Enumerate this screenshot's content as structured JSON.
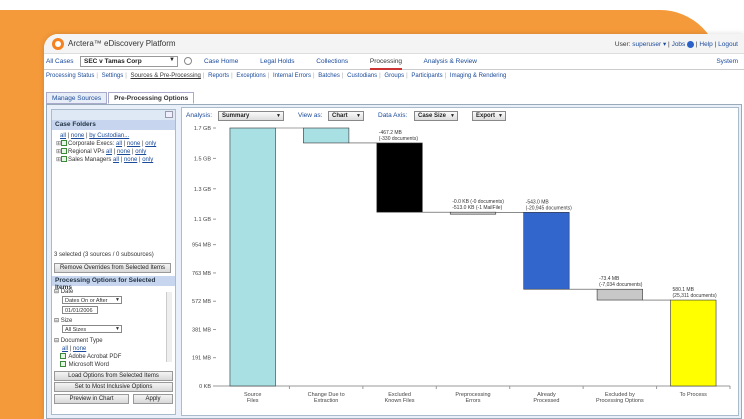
{
  "app": {
    "title": "Arctera™ eDiscovery Platform"
  },
  "userbar": {
    "user_label": "User:",
    "user": "superuser ▾",
    "jobs": "Jobs",
    "help": "Help",
    "logout": "Logout"
  },
  "nav": {
    "all_cases": "All Cases",
    "case_selected": "SEC v Tamas Corp",
    "items": [
      "Case Home",
      "Legal Holds",
      "Collections",
      "Processing",
      "Analysis & Review"
    ],
    "active": "Processing",
    "system": "System"
  },
  "subnav": {
    "items": [
      "Processing Status",
      "Settings",
      "Sources & Pre-Processing",
      "Reports",
      "Exceptions",
      "Internal Errors",
      "Batches",
      "Custodians",
      "Groups",
      "Participants",
      "Imaging & Rendering"
    ],
    "active": "Sources & Pre-Processing"
  },
  "tabs": [
    "Manage Sources",
    "Pre-Processing Options"
  ],
  "left": {
    "case_folders_title": "Case Folders",
    "top_links": [
      "all",
      "none",
      "by Custodian..."
    ],
    "folders": [
      {
        "name": "Corporate Execs",
        "links": [
          "all",
          "none",
          "only"
        ]
      },
      {
        "name": "Regional VPs",
        "links": [
          "all",
          "none",
          "only"
        ]
      },
      {
        "name": "Sales Managers",
        "links": [
          "all",
          "none",
          "only"
        ]
      }
    ],
    "selected_info": "3 selected (3 sources / 0 subsources)",
    "remove_btn": "Remove Overrides from Selected Items",
    "options_title": "Processing Options for Selected Items",
    "date_label": "Date",
    "date_mode": "Dates On or After",
    "date_value": "01/01/2006",
    "size_label": "Size",
    "size_value": "All Sizes",
    "doctype_label": "Document Type",
    "doctype_links": [
      "all",
      "none"
    ],
    "doctypes": [
      "Adobe Acrobat PDF",
      "Microsoft Word"
    ],
    "load_btn": "Load Options from Selected Items",
    "inclusive_btn": "Set to Most Inclusive Options",
    "preview_btn": "Preview in Chart",
    "apply_btn": "Apply"
  },
  "chart_controls": {
    "analysis_label": "Analysis:",
    "analysis_value": "Summary",
    "viewas_label": "View as:",
    "viewas_value": "Chart",
    "axis_label": "Data Axis:",
    "axis_value": "Case Size",
    "export": "Export"
  },
  "chart_data": {
    "type": "bar",
    "subtype": "waterfall",
    "y_ticks": [
      "1.7 GB",
      "1.5 GB",
      "1.3 GB",
      "1.1 GB",
      "954 MB",
      "763 MB",
      "572 MB",
      "381 MB",
      "191 MB",
      "0 KB"
    ],
    "y_tick_values_mb": [
      1741,
      1536,
      1331,
      1126,
      954,
      763,
      572,
      381,
      191,
      0
    ],
    "categories": [
      "Source\nFiles",
      "Change Due to\nExtraction",
      "Excluded\nKnown Files",
      "Preprocessing\nErrors",
      "Already\nProcessed",
      "Excluded by\nProcessing Options",
      "To Process"
    ],
    "bars": [
      {
        "category": "Source Files",
        "start_mb": 0,
        "end_mb": 1741,
        "color": "#a8e0e4"
      },
      {
        "category": "Change Due to Extraction",
        "start_mb": 1741,
        "end_mb": 1640,
        "color": "#a8e0e4"
      },
      {
        "category": "Excluded Known Files",
        "start_mb": 1640,
        "end_mb": 1173,
        "color": "#000000"
      },
      {
        "category": "Preprocessing Errors",
        "start_mb": 1173,
        "end_mb": 1172,
        "color": "#d0d0d0"
      },
      {
        "category": "Already Processed",
        "start_mb": 1172,
        "end_mb": 653,
        "color": "#3366cc"
      },
      {
        "category": "Excluded by Processing Options",
        "start_mb": 653,
        "end_mb": 580,
        "color": "#c8c8c8"
      },
      {
        "category": "To Process",
        "start_mb": 580,
        "end_mb": 0,
        "color": "#ffff00"
      }
    ],
    "annotations": [
      {
        "category": "Excluded Known Files",
        "lines": [
          "-467.2 MB",
          "(-330 documents)"
        ]
      },
      {
        "category": "Preprocessing Errors",
        "lines": [
          "-0.0 KB (-0 documents)",
          "-513.0 KB (-1 MailFile)"
        ]
      },
      {
        "category": "Already Processed",
        "lines": [
          "-543.0 MB",
          "(-20,945 documents)"
        ]
      },
      {
        "category": "Excluded by Processing Options",
        "lines": [
          "-73.4 MB",
          "(-7,034 documents)"
        ]
      },
      {
        "category": "To Process",
        "lines": [
          "580.1 MB",
          "(25,311 documents)"
        ]
      }
    ],
    "ylim": [
      0,
      1741
    ]
  }
}
